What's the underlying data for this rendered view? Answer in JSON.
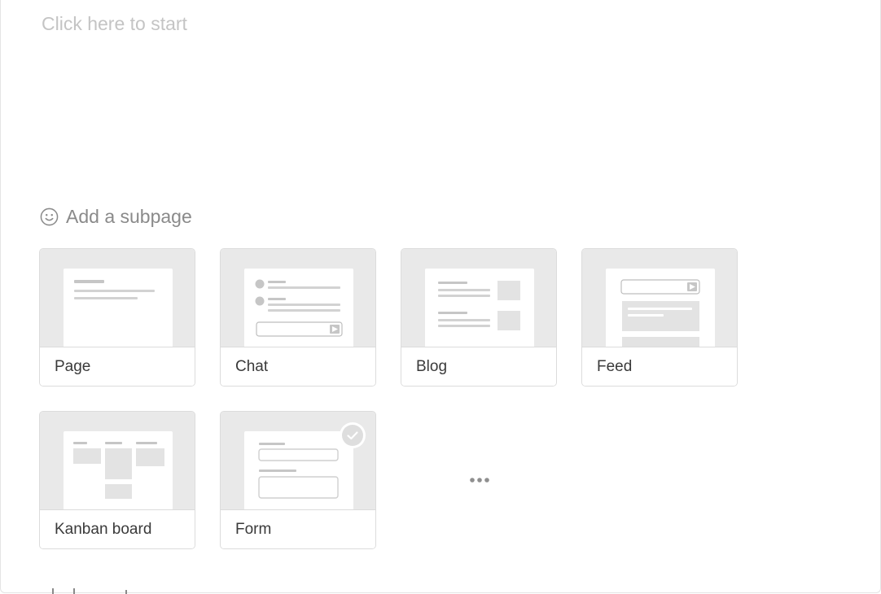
{
  "editor": {
    "placeholder": "Click here to start"
  },
  "subpage": {
    "heading": "Add a subpage",
    "icon": "smiley-icon"
  },
  "templates": [
    {
      "id": "page",
      "label": "Page"
    },
    {
      "id": "chat",
      "label": "Chat"
    },
    {
      "id": "blog",
      "label": "Blog"
    },
    {
      "id": "feed",
      "label": "Feed"
    },
    {
      "id": "kanban",
      "label": "Kanban board"
    },
    {
      "id": "form",
      "label": "Form",
      "selected": true
    }
  ],
  "more": {
    "icon": "more-horizontal-icon"
  },
  "colors": {
    "thumb_background": "#e9e9e9",
    "muted_text": "#8a8a8a",
    "placeholder_text": "#c4c4c4",
    "label_text": "#3a3a3a"
  }
}
